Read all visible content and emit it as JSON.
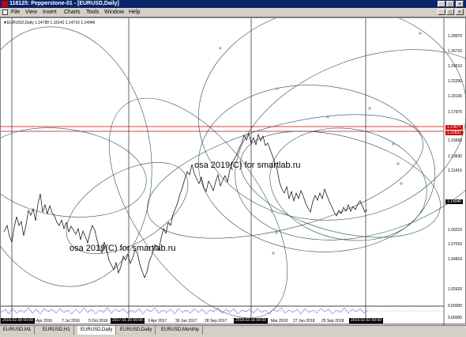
{
  "window": {
    "title": "118125: Pepperstone-01 - [EURUSD,Daily]",
    "controls": [
      "_",
      "□",
      "×"
    ]
  },
  "menu": {
    "items": [
      "File",
      "View",
      "Insert",
      "Charts",
      "Tools",
      "Window",
      "Help"
    ],
    "inner_controls": [
      "_",
      "□",
      "×"
    ]
  },
  "chart": {
    "symbol_info": "▼EURUSD,Daily  1.14788 1.15142 1.14716 1.14946",
    "watermark_1": "osa 2019(C) for smartlab.ru",
    "watermark_2": "osa 2019(C) for smartlab.ru",
    "price_labels": [
      "1.28970",
      "1.26710",
      "1.24510",
      "1.22290",
      "1.20130",
      "1.17970",
      "1.15650",
      "1.13630",
      "1.11410",
      "1.09210",
      "1.07010",
      "1.04810",
      "1.02620"
    ],
    "price_scale": [
      1.2897,
      1.0262
    ],
    "price_tags": [
      {
        "value": "1.23677",
        "color": "#d00000"
      },
      {
        "value": "1.22831",
        "color": "#d00000"
      },
      {
        "value": "1.14946",
        "color": "#000000"
      }
    ],
    "date_labels": [
      "6 Apr 2016",
      "7 Jul 2016",
      "5 Oct 2016",
      "3 Apr 2017",
      "30 Jun 2017",
      "28 Sep 2017",
      "Mar 2018",
      "27 Jun 2018",
      "25 Sep 2018"
    ],
    "date_tags": [
      "2016.02.08 00:00",
      "2017.01.20 00:00",
      "2018.02.16 00:00",
      "2019.02.02 00:00"
    ],
    "osc_top": "0.00000",
    "osc_bottom": "0.00000",
    "colors": {
      "accent_red": "#d00000",
      "line_dark": "#2f4f4f"
    }
  },
  "tabs": {
    "items": [
      "EURUSD,M1",
      "EURUSD,H1",
      "EURUSD,Daily",
      "EURUSD,Daily",
      "EURUSD,Monthly"
    ],
    "active": "EURUSD,Daily"
  }
}
